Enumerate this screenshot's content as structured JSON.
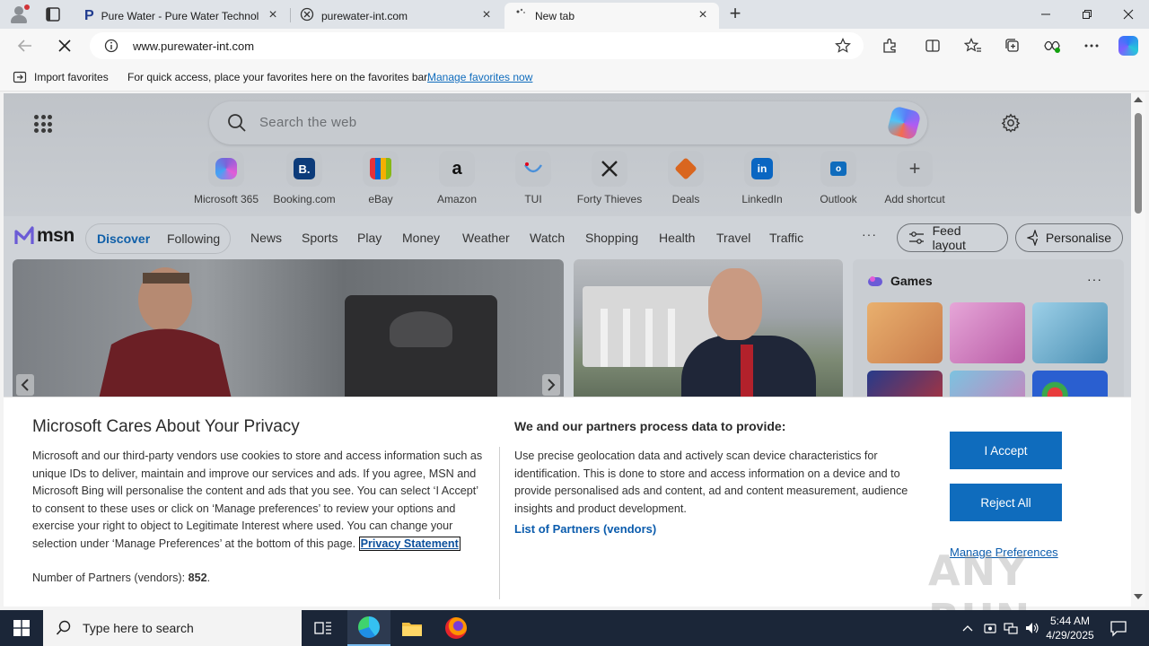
{
  "browser": {
    "tabs": [
      {
        "title": "Pure Water - Pure Water Technol",
        "icon": "p-logo-icon"
      },
      {
        "title": "purewater-int.com",
        "icon": "globe-icon"
      },
      {
        "title": "New tab",
        "icon": "loading-icon"
      }
    ],
    "url": "www.purewater-int.com"
  },
  "favbar": {
    "import_label": "Import favorites",
    "message": "For quick access, place your favorites here on the favorites bar.",
    "manage_link": "Manage favorites now"
  },
  "ntp": {
    "search_placeholder": "Search the web",
    "shortcuts": [
      {
        "label": "Microsoft 365",
        "color": "#7b62d8"
      },
      {
        "label": "Booking.com",
        "color": "#0c3b7a"
      },
      {
        "label": "eBay",
        "color": "#e53238"
      },
      {
        "label": "Amazon",
        "color": "#232f3e"
      },
      {
        "label": "TUI",
        "color": "#4a90d9"
      },
      {
        "label": "Forty Thieves",
        "color": "#2c2c2c"
      },
      {
        "label": "Deals",
        "color": "#d9661f"
      },
      {
        "label": "LinkedIn",
        "color": "#0a66c2"
      },
      {
        "label": "Outlook",
        "color": "#0f6cbd"
      },
      {
        "label": "Add shortcut",
        "color": "#555555"
      }
    ]
  },
  "msn": {
    "logo": "msn",
    "segment": {
      "discover": "Discover",
      "following": "Following"
    },
    "nav": [
      "News",
      "Sports",
      "Play",
      "Money",
      "Weather",
      "Watch",
      "Shopping",
      "Health",
      "Travel",
      "Traffic"
    ],
    "more": "···",
    "feed_layout": "Feed layout",
    "personalise": "Personalise",
    "games_title": "Games"
  },
  "consent": {
    "title": "Microsoft Cares About Your Privacy",
    "body": "Microsoft and our third-party vendors use cookies to store and access information such as unique IDs to deliver, maintain and improve our services and ads. If you agree, MSN and Microsoft Bing will personalise the content and ads that you see. You can select ‘I Accept’ to consent to these uses or click on ‘Manage preferences’ to review your options and exercise your right to object to Legitimate Interest where used.  You can change your selection under ‘Manage Preferences’ at the bottom of this page.",
    "privacy_link": "Privacy Statement",
    "partners_label": "Number of Partners (vendors):",
    "partners_count": "852",
    "purpose_title": "We and our partners process data to provide:",
    "purpose_text": "Use precise geolocation data and actively scan device characteristics for identification. This is done to store and access information on a device and to provide personalised ads and content, ad and content measurement, audience insights and product development.",
    "vendors_link": "List of Partners (vendors)",
    "accept": "I Accept",
    "reject": "Reject All",
    "manage": "Manage Preferences"
  },
  "watermark": "ANY RUN",
  "taskbar": {
    "search_placeholder": "Type here to search",
    "time": "5:44 AM",
    "date": "4/29/2025"
  }
}
